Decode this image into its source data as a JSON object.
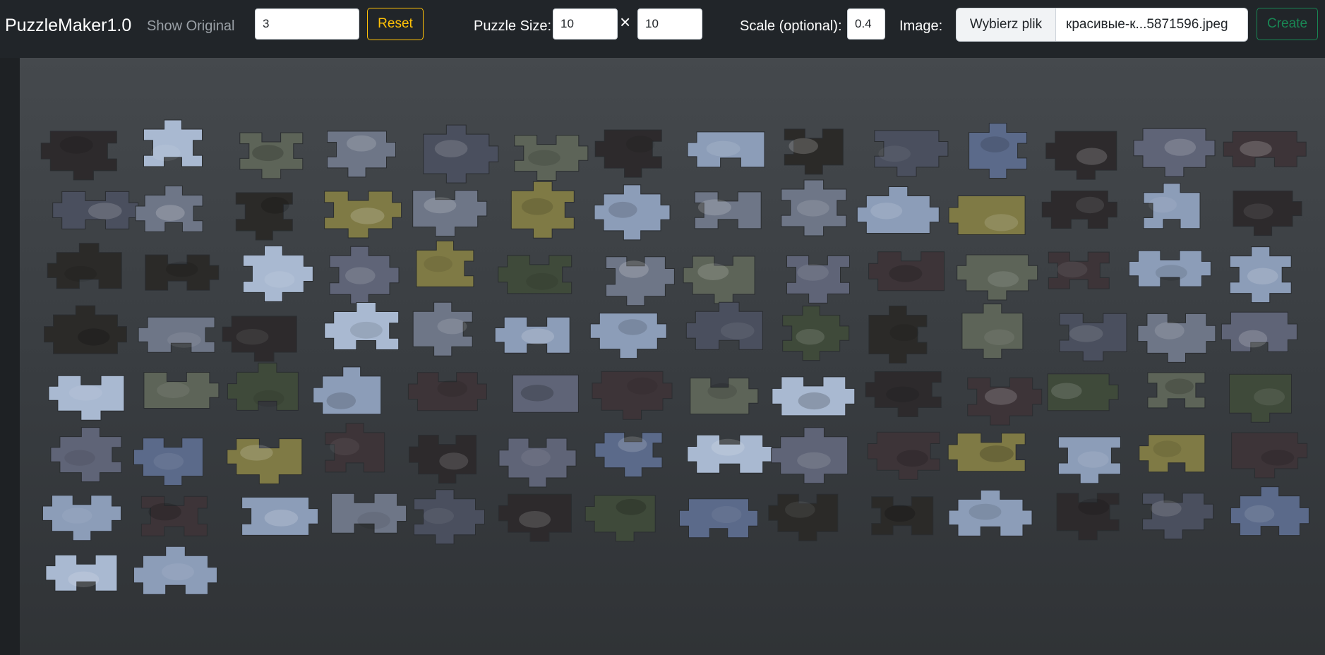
{
  "app": {
    "brand": "PuzzleMaker1.0",
    "show_original_label": "Show Original"
  },
  "toolbar": {
    "seed_value": "3",
    "reset_label": "Reset",
    "puzzle_size_label": "Puzzle Size:",
    "size_rows": "10",
    "size_separator": "×",
    "size_cols": "10",
    "scale_label": "Scale (optional):",
    "scale_value": "0.4",
    "image_label": "Image:",
    "file_button_label": "Wybierz plik",
    "file_name": "красивые-к...5871596.jpeg",
    "create_label": "Create"
  },
  "colors": {
    "navbar_bg": "#212529",
    "reset_accent": "#ffc107",
    "create_accent": "#198754",
    "board_bg": "#3d4144"
  },
  "puzzle": {
    "pieces_total": 100,
    "piece_tones": [
      "#8c9db8",
      "#3d3438",
      "#6e7687",
      "#4a4f5e",
      "#2b2a28",
      "#5b6a8a",
      "#7f7a45",
      "#2d2a2c",
      "#5f6477",
      "#3f4a3a",
      "#a9b9d1",
      "#5d6458"
    ]
  }
}
